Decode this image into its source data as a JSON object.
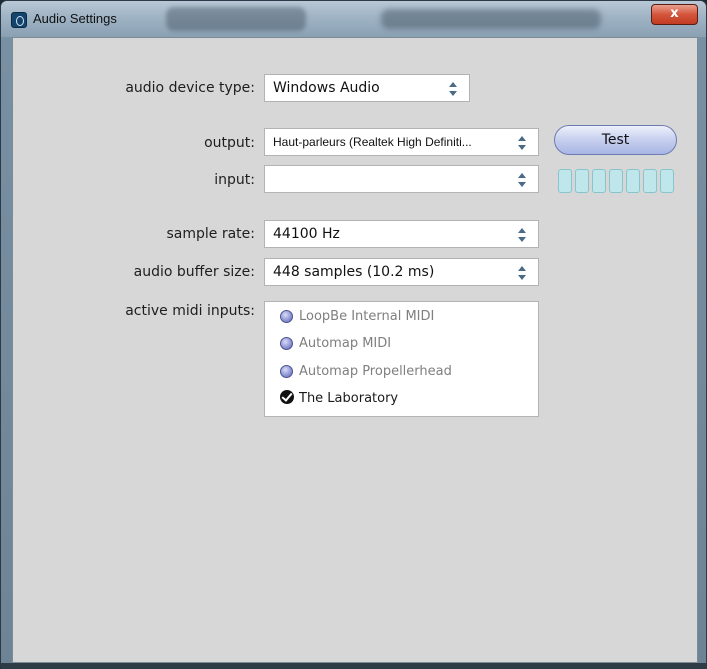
{
  "window": {
    "title": "Audio Settings",
    "close_label": "x"
  },
  "fields": {
    "device_type": {
      "label": "audio device type:",
      "value": "Windows Audio"
    },
    "output": {
      "label": "output:",
      "value": "Haut-parleurs (Realtek High Definiti..."
    },
    "input": {
      "label": "input:",
      "value": ""
    },
    "sample_rate": {
      "label": "sample rate:",
      "value": "44100 Hz"
    },
    "buffer_size": {
      "label": "audio buffer size:",
      "value": "448 samples (10.2 ms)"
    },
    "midi_inputs": {
      "label": "active midi inputs:"
    }
  },
  "test_button": {
    "label": "Test"
  },
  "input_level": {
    "segments": 7,
    "level": 0
  },
  "midi_inputs": [
    {
      "name": "LoopBe Internal MIDI",
      "enabled": false
    },
    {
      "name": "Automap MIDI",
      "enabled": false
    },
    {
      "name": "Automap Propellerhead",
      "enabled": false
    },
    {
      "name": "The Laboratory",
      "enabled": true
    }
  ],
  "colors": {
    "client_bg": "#d7d7d7",
    "close_button": "#c23b22",
    "test_button": "#c9d1ef",
    "level_meter": "#bfe6ea",
    "radio_dot": "#8f98d6"
  }
}
